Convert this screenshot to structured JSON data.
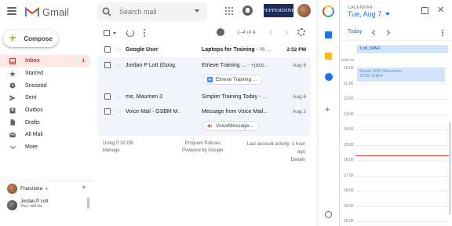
{
  "header": {
    "app_name": "Gmail",
    "search_placeholder": "Search mail",
    "pepperdine_text": "PEPPERDINE"
  },
  "sidebar": {
    "compose_label": "Compose",
    "items": [
      {
        "label": "Inbox",
        "count": "1",
        "icon": "inbox-icon",
        "active": true
      },
      {
        "label": "Starred",
        "count": "",
        "icon": "star-icon"
      },
      {
        "label": "Snoozed",
        "count": "",
        "icon": "clock-icon"
      },
      {
        "label": "Sent",
        "count": "",
        "icon": "send-icon"
      },
      {
        "label": "Outbox",
        "count": "",
        "icon": "outbox-icon"
      },
      {
        "label": "Drafts",
        "count": "",
        "icon": "draft-icon"
      },
      {
        "label": "All Mail",
        "count": "",
        "icon": "mail-icon"
      },
      {
        "label": "More",
        "count": "",
        "icon": "chevron-down-icon"
      }
    ]
  },
  "hangouts": {
    "me_name": "Franziska",
    "contact_name": "Jordan P Lott",
    "contact_status": "You: will do."
  },
  "toolbar": {
    "range": "1–4 of 4"
  },
  "emails": [
    {
      "from": "Google User",
      "subject": "Laptops for Training",
      "snippet": " - Hi ...",
      "date": "2:52 PM",
      "unread": true,
      "attachment": ""
    },
    {
      "from": "Jordan P Lott (Goog.",
      "subject": "Etrieve Training ...",
      "snippet": " - +jaso...",
      "date": "Aug 6",
      "unread": false,
      "attachment": "Etrieve Training ..."
    },
    {
      "from": "me, Maureen 3",
      "subject": "Simpler Training Today",
      "snippet": " - ...",
      "date": "Aug 6",
      "unread": false,
      "attachment": ""
    },
    {
      "from": "Voice Mail - GSBM M.",
      "subject": "Message from Voice Mail...",
      "snippet": "",
      "date": "Aug 2",
      "unread": false,
      "attachment": "VoiceMessage..."
    }
  ],
  "footer": {
    "usage": "Using 0.32 GB",
    "manage": "Manage",
    "policies": "Program Policies",
    "powered": "Powered by Google",
    "activity": "Last account activity: 1 hour ago",
    "details": "Details"
  },
  "calendar": {
    "label": "CALENDAR",
    "date": "Tue, Aug 7",
    "today_label": "Today",
    "allday_event": "Lott_WAH",
    "timezone": "GMT-07",
    "hours": [
      "10:00",
      "11:00",
      "12:00",
      "13:00",
      "14:00",
      "15:00",
      "16:00",
      "17:00",
      "18:00",
      "19:00",
      "20:00"
    ],
    "event_title": "Seaver NSO Discussion",
    "event_time": "10:00, Online"
  },
  "colors": {
    "accent": "#1a73e8",
    "inbox_active": "#d93025",
    "inbox_bg": "#fce8e6",
    "now_line": "#ea4335"
  }
}
